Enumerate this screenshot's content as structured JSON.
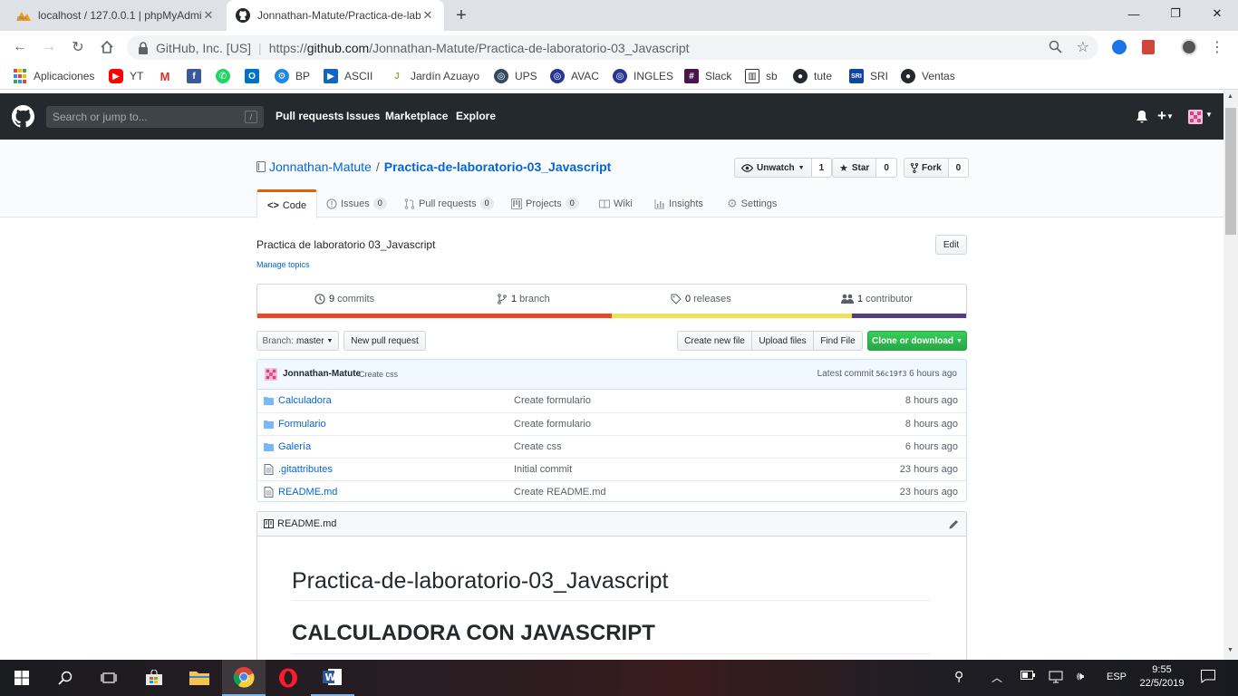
{
  "browser": {
    "tabs": [
      {
        "title": "localhost / 127.0.0.1 | phpMyAdmin",
        "favicon": "phpmyadmin-icon"
      },
      {
        "title": "Jonnathan-Matute/Practica-de-laboratorio-03_Javascript",
        "favicon": "github-icon"
      }
    ],
    "security_label": "GitHub, Inc. [US]",
    "url_prefix": "https://",
    "url_host": "github.com",
    "url_path": "/Jonnathan-Matute/Practica-de-laboratorio-03_Javascript",
    "bookmarks": [
      "Aplicaciones",
      "YT",
      "",
      "",
      "",
      "",
      "BP",
      "ASCII",
      "Jardín Azuayo",
      "UPS",
      "AVAC",
      "INGLES",
      "Slack",
      "sb",
      "tute",
      "SRI",
      "Ventas"
    ]
  },
  "github": {
    "search_placeholder": "Search or jump to...",
    "search_key": "/",
    "nav": [
      "Pull requests",
      "Issues",
      "Marketplace",
      "Explore"
    ]
  },
  "repo": {
    "owner": "Jonnathan-Matute",
    "separator": "/",
    "name": "Practica-de-laboratorio-03_Javascript",
    "watch_label": "Unwatch",
    "watch_count": "1",
    "star_label": "Star",
    "star_count": "0",
    "fork_label": "Fork",
    "fork_count": "0",
    "tabs": {
      "code": "Code",
      "issues": "Issues",
      "issues_count": "0",
      "pulls": "Pull requests",
      "pulls_count": "0",
      "projects": "Projects",
      "projects_count": "0",
      "wiki": "Wiki",
      "insights": "Insights",
      "settings": "Settings"
    },
    "description": "Practica de laboratorio 03_Javascript",
    "edit_label": "Edit",
    "manage_topics": "Manage topics",
    "summary": {
      "commits_num": "9",
      "commits_label": "commits",
      "branch_num": "1",
      "branch_label": "branch",
      "releases_num": "0",
      "releases_label": "releases",
      "contrib_num": "1",
      "contrib_label": "contributor"
    },
    "language_colors": [
      "#e34c26",
      "#f1e05a",
      "#563d7c"
    ],
    "branch_label": "Branch:",
    "branch_value": "master",
    "new_pr": "New pull request",
    "create_file": "Create new file",
    "upload_files": "Upload files",
    "find_file": "Find File",
    "clone": "Clone or download",
    "commit": {
      "author": "Jonnathan-Matute",
      "message": "Create css",
      "latest_label": "Latest commit",
      "sha": "56c19f3",
      "time": "6 hours ago"
    },
    "files": [
      {
        "name": "Calculadora",
        "type": "dir",
        "message": "Create formulario",
        "age": "8 hours ago"
      },
      {
        "name": "Formulario",
        "type": "dir",
        "message": "Create formulario",
        "age": "8 hours ago"
      },
      {
        "name": "Galería",
        "type": "dir",
        "message": "Create css",
        "age": "6 hours ago"
      },
      {
        "name": ".gitattributes",
        "type": "file",
        "message": "Initial commit",
        "age": "23 hours ago"
      },
      {
        "name": "README.md",
        "type": "file",
        "message": "Create README.md",
        "age": "23 hours ago"
      }
    ],
    "readme": {
      "filename": "README.md",
      "h1": "Practica-de-laboratorio-03_Javascript",
      "h2": "CALCULADORA CON JAVASCRIPT"
    }
  },
  "taskbar": {
    "lang": "ESP",
    "time": "9:55",
    "date": "22/5/2019"
  }
}
